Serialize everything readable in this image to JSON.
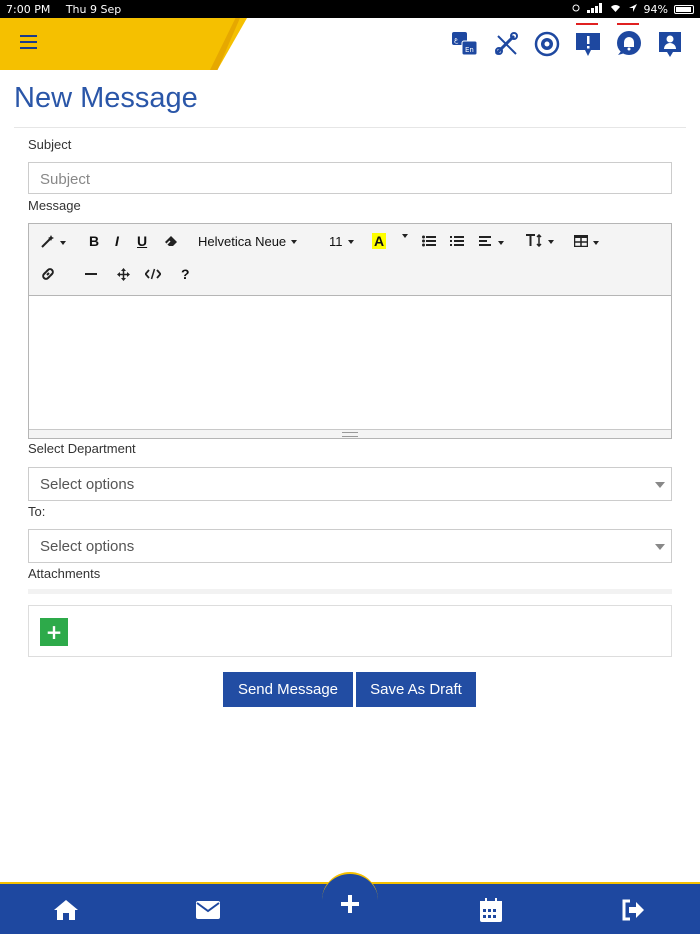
{
  "status_bar": {
    "time": "7:00 PM",
    "date": "Thu 9 Sep",
    "battery": "94%"
  },
  "header": {
    "icons": [
      "translate-icon",
      "tools-icon",
      "settings-sync-icon",
      "alert-icon",
      "notification-bell-icon",
      "profile-icon"
    ]
  },
  "page": {
    "title": "New Message"
  },
  "form": {
    "subject_label": "Subject",
    "subject_placeholder": "Subject",
    "message_label": "Message",
    "department_label": "Select Department",
    "department_value": "Select options",
    "to_label": "To:",
    "to_value": "Select options",
    "attachments_label": "Attachments",
    "add_attachment": "+"
  },
  "editor": {
    "font_name": "Helvetica Neue",
    "font_size": "11",
    "help": "?"
  },
  "actions": {
    "send": "Send Message",
    "draft": "Save As Draft"
  },
  "bottom_nav": [
    "home-icon",
    "mail-icon",
    "add-icon",
    "calendar-icon",
    "logout-icon"
  ],
  "colors": {
    "brand_blue": "#1e48a0",
    "accent_yellow": "#f5c000",
    "add_green": "#2daa4a"
  }
}
